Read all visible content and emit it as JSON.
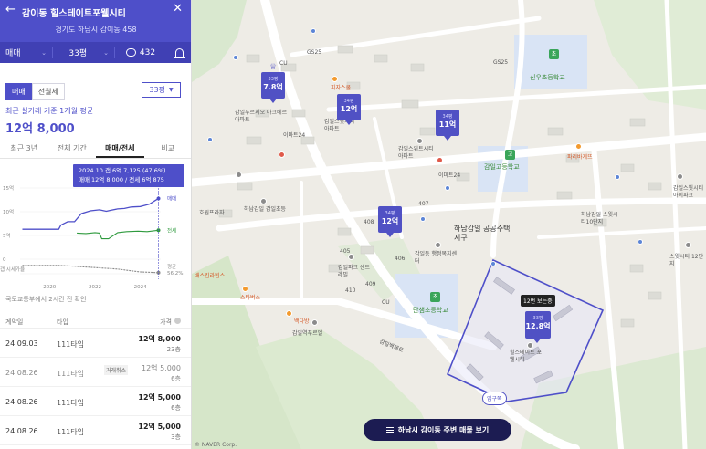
{
  "header": {
    "title": "감이동 힐스테이트포웰시티",
    "address": "경기도 하남시 감이동 458",
    "deal_type": "매매",
    "size": "33평",
    "comment_count": "432"
  },
  "price": {
    "tab_sale": "매매",
    "tab_lease": "전월세",
    "size_select": "33평",
    "label": "최근 실거래 기준 1개월 평균",
    "value": "12억 8,000"
  },
  "period_tabs": [
    "최근 3년",
    "전체 기간",
    "매매/전세",
    "비교"
  ],
  "chart_data": {
    "type": "line",
    "tooltip": [
      "2024.10  갭 6억 7,125 (47.6%)",
      "매매 12억 8,000 / 전세 6억 875"
    ],
    "y_ticks": [
      "15억",
      "10억",
      "5억",
      "0"
    ],
    "x_ticks": [
      "2020",
      "2022",
      "2024"
    ],
    "ylim": [
      0,
      15
    ],
    "series": [
      {
        "name": "매매",
        "color": "#4e4fc9",
        "x": [
          2018.8,
          2019.4,
          2019.9,
          2020.4,
          2020.5,
          2020.8,
          2021.1,
          2021.4,
          2021.8,
          2022.2,
          2022.5,
          2022.7,
          2023.0,
          2023.3,
          2023.6,
          2024.0,
          2024.4,
          2024.8
        ],
        "values": [
          6.3,
          6.3,
          6.3,
          6.3,
          7.2,
          7.9,
          7.9,
          9.6,
          10.2,
          10.4,
          10.1,
          10.3,
          10.6,
          10.7,
          11.0,
          11.1,
          11.6,
          12.8
        ]
      },
      {
        "name": "전세",
        "color": "#2f9a3e",
        "x": [
          2021.2,
          2021.6,
          2022.0,
          2022.2,
          2022.3,
          2022.6,
          2023.0,
          2023.4,
          2023.9,
          2024.3,
          2024.8
        ],
        "values": [
          5.5,
          5.4,
          5.6,
          5.5,
          4.3,
          4.3,
          5.6,
          5.8,
          5.9,
          5.8,
          6.1
        ]
      },
      {
        "name": "평균 갭가율",
        "color": "#8a8a8a",
        "x": [
          2018.8,
          2019.5,
          2020.4,
          2021.0,
          2021.5,
          2022.0,
          2022.5,
          2023.0,
          2023.5,
          2024.0,
          2024.8
        ],
        "values": [
          1.3,
          1.3,
          1.3,
          1.2,
          1.1,
          1.0,
          0.9,
          0.8,
          0.6,
          0.4,
          0.3
        ]
      }
    ],
    "end_labels": {
      "sale": "매매",
      "lease": "전세",
      "avg": "평균",
      "avg_value": "56.2%",
      "gap_label": "갭 시세가율"
    }
  },
  "source_note": "국토교통부에서 2시간 전 확인",
  "table": {
    "headers": [
      "계약일",
      "타입",
      "가격"
    ],
    "rows": [
      {
        "date": "24.09.03",
        "type": "111타입",
        "badge": "",
        "price": "12억 8,000",
        "floor": "23층",
        "faded": false
      },
      {
        "date": "24.08.26",
        "type": "111타입",
        "badge": "거래취소",
        "price": "12억 5,000",
        "floor": "6층",
        "faded": true
      },
      {
        "date": "24.08.26",
        "type": "111타입",
        "badge": "",
        "price": "12억 5,000",
        "floor": "6층",
        "faded": false
      },
      {
        "date": "24.08.26",
        "type": "111타입",
        "badge": "",
        "price": "12억 5,000",
        "floor": "3층",
        "faded": false
      }
    ]
  },
  "map": {
    "pins": [
      {
        "size": "33평",
        "price": "7.8억"
      },
      {
        "size": "34평",
        "price": "12억"
      },
      {
        "size": "34평",
        "price": "11억"
      },
      {
        "size": "34평",
        "price": "12억"
      },
      {
        "size": "33평",
        "price": "12.8억"
      }
    ],
    "labels": {
      "complex_badge": "12번 보는중",
      "entrance": "입구쪽",
      "cta": "하남시 감이동 주변 매물 보기",
      "copyright": "© NAVER Corp.",
      "school1": "신우초등학교",
      "school2": "감일고등학교",
      "school3": "단샘초등학교",
      "area": "하남감일 공공주택지구",
      "apt1": "감일푸르지오 마크베르아파트",
      "apt2": "감일스윗시티 아파트",
      "apt3": "감일파크 센트레빌",
      "apt4": "힐스테이트 포웰시티",
      "apt5": "감일역푸르엘",
      "apt6": "감일스위트시티 아파트",
      "office": "감일동 행정복지센터",
      "road": "감일백제로",
      "mart1": "이마트24",
      "mart2": "이마트24",
      "gs1": "GS25",
      "gs2": "GS25",
      "pizza": "피자스쿨",
      "cu1": "CU",
      "cu2": "CU",
      "starbucks": "스타벅스",
      "paris": "파리바게뜨",
      "baskin": "배스킨라빈스",
      "convention": "호원프라자",
      "daycare": "하남감일 감일초등",
      "elem": "감일초등학교",
      "church": "하남감일 스윗시티10단지",
      "ilmin": "감일스윗시티 아이파크",
      "bk": "백다방",
      "num405": "405",
      "num406": "406",
      "num407": "407",
      "num408": "408",
      "num409": "409",
      "num410": "410",
      "aptGS": "스윗시티 12단지"
    }
  }
}
